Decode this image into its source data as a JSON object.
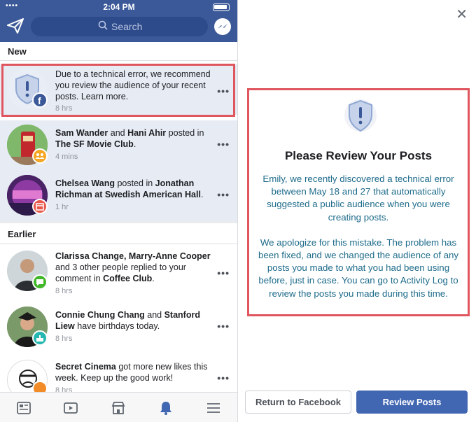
{
  "status_bar": {
    "signal": "••••",
    "time": "2:04 PM"
  },
  "header": {
    "search_placeholder": "Search"
  },
  "sections": {
    "new": "New",
    "earlier": "Earlier"
  },
  "notifications": [
    {
      "parts": [
        {
          "t": "Due to a technical error, we recommend you review the audience of your recent posts. Learn more.",
          "b": false
        }
      ],
      "time": "8 hrs",
      "unread": true
    },
    {
      "parts": [
        {
          "t": "Sam Wander",
          "b": true
        },
        {
          "t": " and ",
          "b": false
        },
        {
          "t": "Hani Ahir",
          "b": true
        },
        {
          "t": " posted in ",
          "b": false
        },
        {
          "t": "The SF Movie Club",
          "b": true
        },
        {
          "t": ".",
          "b": false
        }
      ],
      "time": "4 mins",
      "unread": true
    },
    {
      "parts": [
        {
          "t": "Chelsea Wang",
          "b": true
        },
        {
          "t": " posted in ",
          "b": false
        },
        {
          "t": "Jonathan Richman at Swedish American Hall",
          "b": true
        },
        {
          "t": ".",
          "b": false
        }
      ],
      "time": "1 hr",
      "unread": true
    },
    {
      "parts": [
        {
          "t": "Clarissa Change, Marry-Anne Cooper",
          "b": true
        },
        {
          "t": " and 3 other people replied to your comment in ",
          "b": false
        },
        {
          "t": "Coffee Club",
          "b": true
        },
        {
          "t": ".",
          "b": false
        }
      ],
      "time": "8 hrs",
      "unread": false
    },
    {
      "parts": [
        {
          "t": "Connie Chung Chang",
          "b": true
        },
        {
          "t": " and ",
          "b": false
        },
        {
          "t": "Stanford Liew",
          "b": true
        },
        {
          "t": " have birthdays today.",
          "b": false
        }
      ],
      "time": "8 hrs",
      "unread": false
    },
    {
      "parts": [
        {
          "t": "Secret Cinema",
          "b": true
        },
        {
          "t": " got more new likes this week. Keep up the good work!",
          "b": false
        }
      ],
      "time": "8 hrs",
      "unread": false
    }
  ],
  "more_label": "•••",
  "modal": {
    "title": "Please Review Your Posts",
    "para1": "Emily, we recently discovered a technical error between May 18 and 27 that automatically suggested a public audience when you were creating posts.",
    "para2": "We apologize for this mistake. The problem has been fixed, and we changed the audience of any posts you made to what you had been using before, just in case. You can go to Activity Log to review the posts you made during this time.",
    "return_button": "Return to Facebook",
    "review_button": "Review Posts",
    "close": "✕"
  },
  "colors": {
    "brand": "#3b5998",
    "button_blue": "#4267b2",
    "highlight_red": "#e0565e",
    "unread_bg": "#e7ebf4",
    "body_text_teal": "#1d6b8a"
  }
}
